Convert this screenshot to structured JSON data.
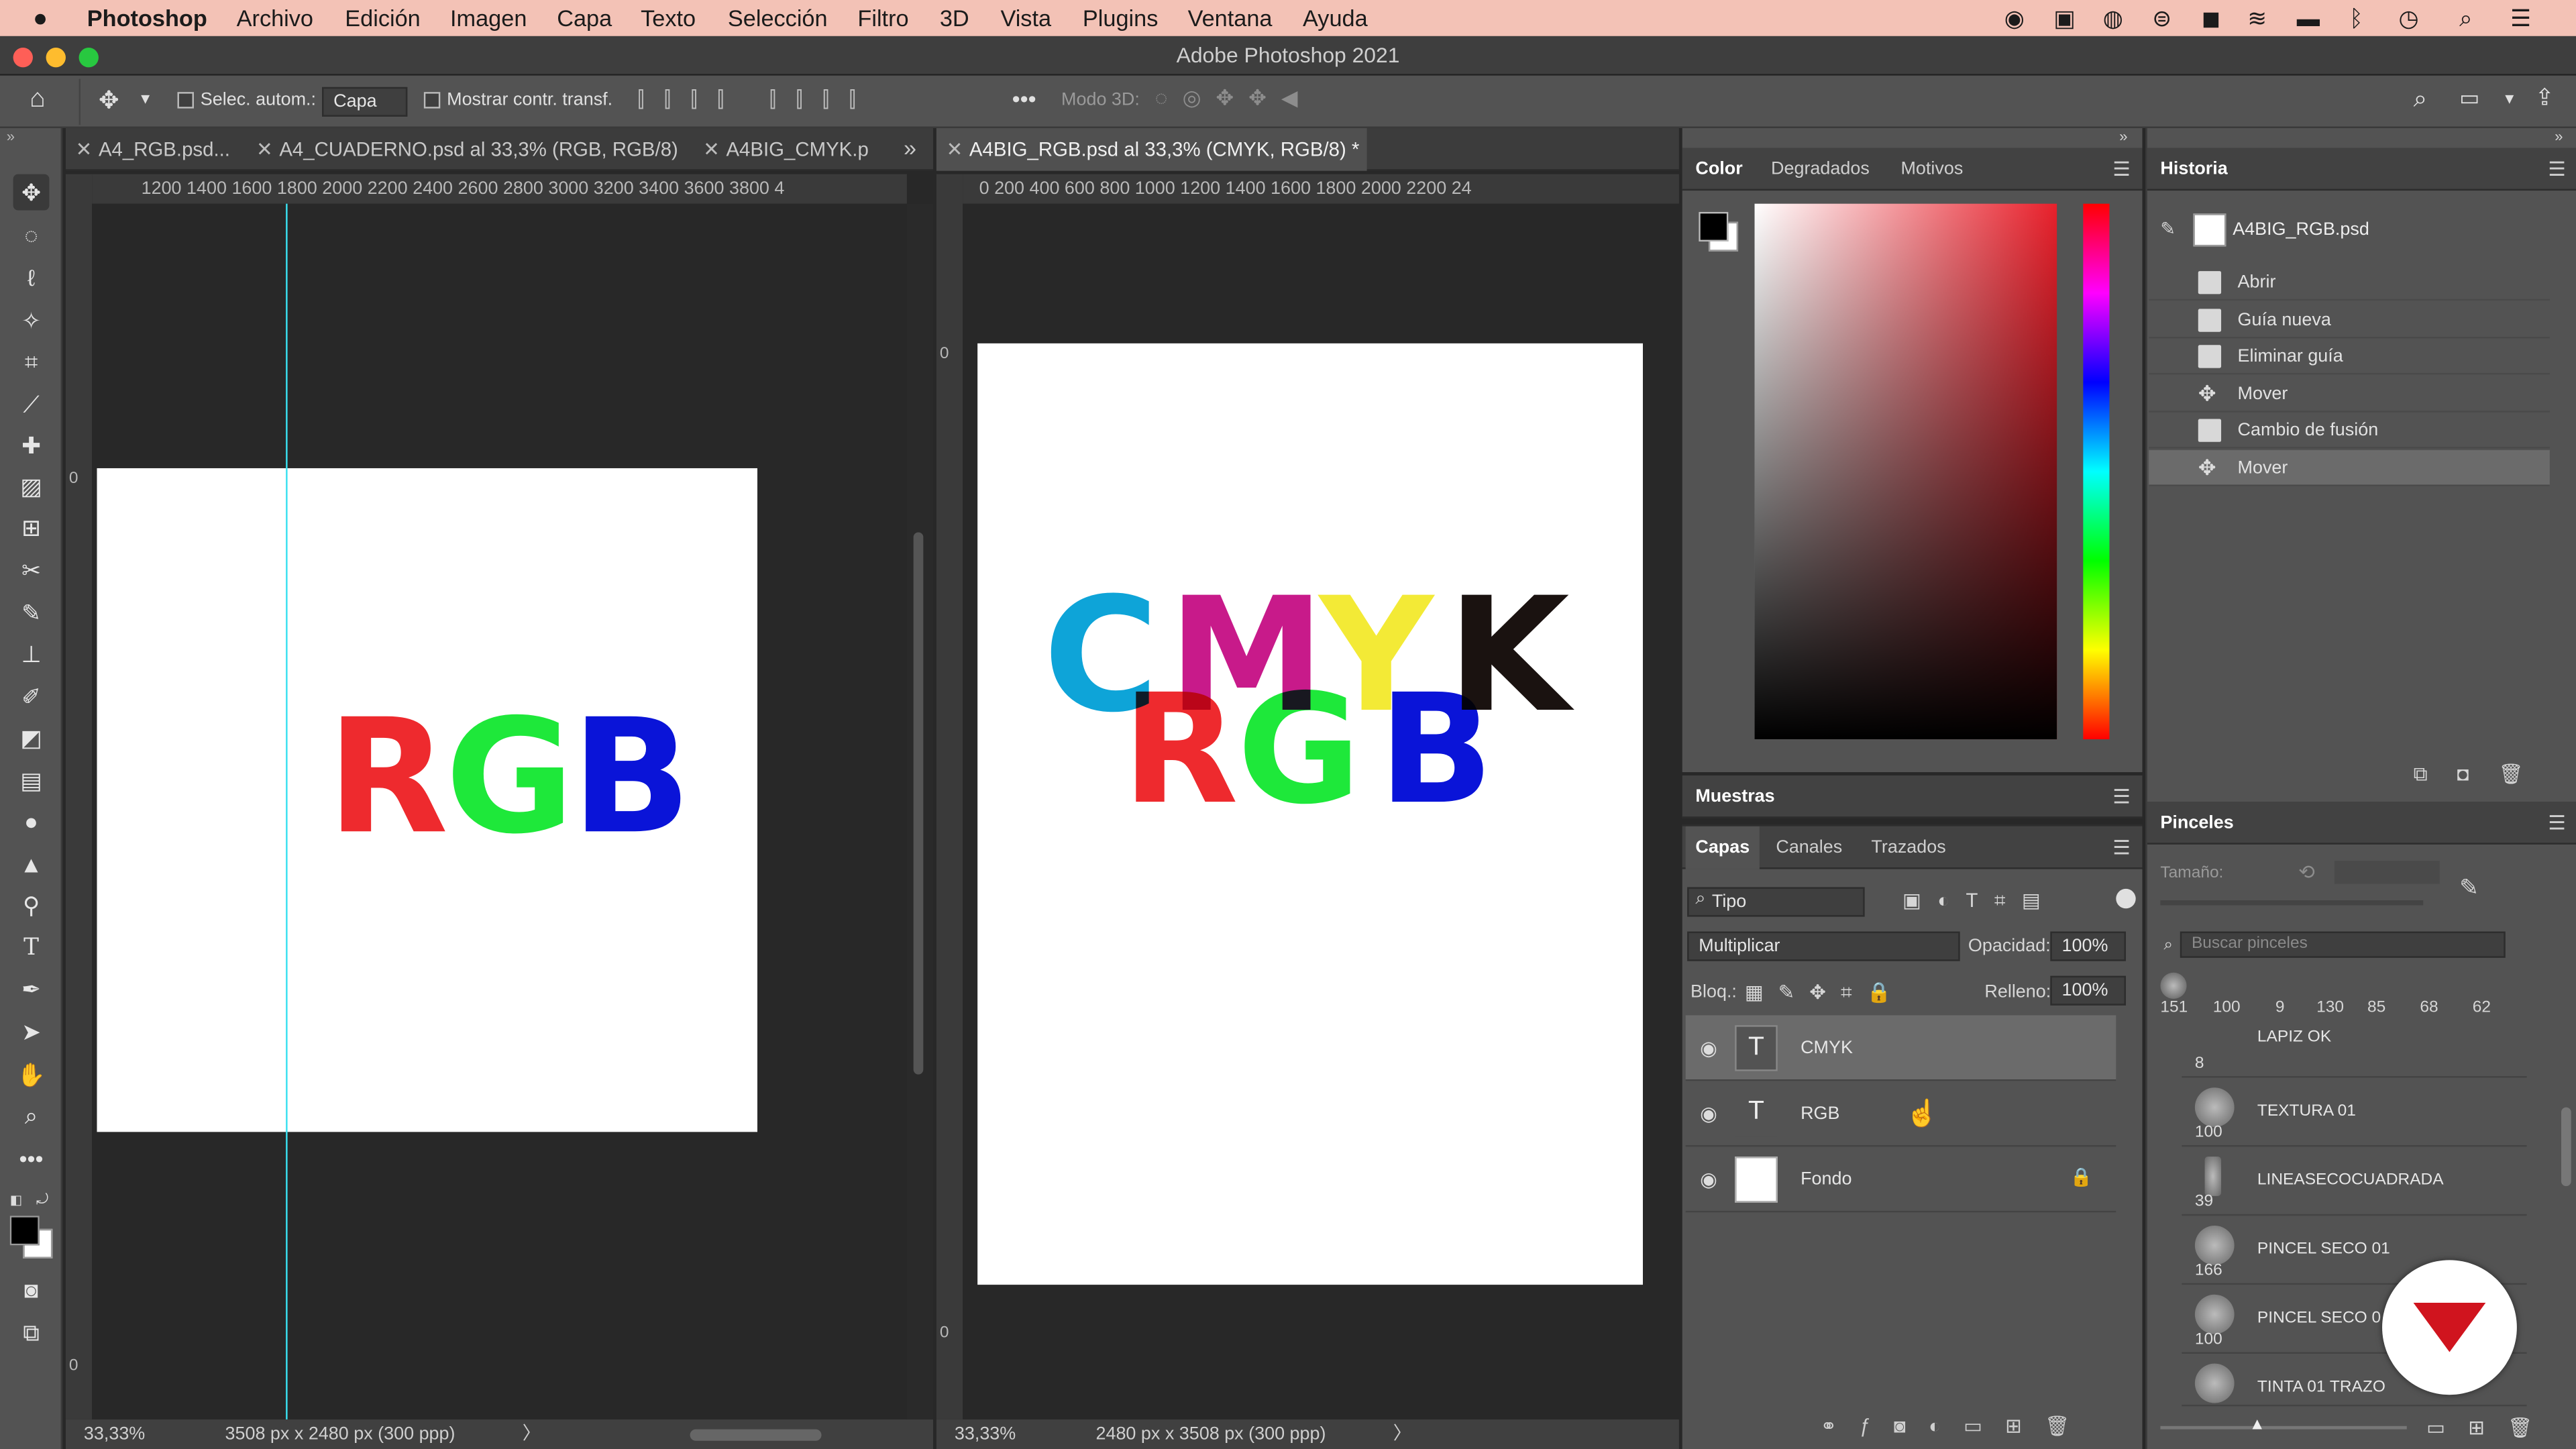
{
  "menubar": {
    "apple": "",
    "app": "Photoshop",
    "items": [
      "Archivo",
      "Edición",
      "Imagen",
      "Capa",
      "Texto",
      "Selección",
      "Filtro",
      "3D",
      "Vista",
      "Plugins",
      "Ventana",
      "Ayuda"
    ]
  },
  "window": {
    "title": "Adobe Photoshop 2021"
  },
  "options": {
    "auto_select_label": "Selec. autom.:",
    "auto_select_value": "Capa",
    "show_transform_label": "Mostrar contr. transf.",
    "mode3d_label": "Modo 3D:"
  },
  "left_doc": {
    "tabs": [
      {
        "label": "A4_RGB.psd..."
      },
      {
        "label": "A4_CUADERNO.psd al 33,3% (RGB, RGB/8) *"
      },
      {
        "label": "A4BIG_CMYK.p"
      }
    ],
    "ruler": "1200 1400 1600 1800 2000 2200 2400 2600 2800 3000 3200 3400 3600 3800 4",
    "vruler": [
      "0",
      "0"
    ],
    "text": "RGB",
    "colors": {
      "r": "#ee2a2e",
      "g": "#1ee83a",
      "b": "#0a14d8"
    },
    "zoom": "33,33%",
    "dims": "3508 px x 2480 px (300 ppp)",
    "arrow": "〉"
  },
  "right_doc": {
    "tab": "A4BIG_RGB.psd al 33,3% (CMYK, RGB/8) *",
    "ruler": "0   200  400  600  800  1000 1200 1400 1600 1800 2000 2200 24",
    "vruler": [
      "0",
      "0"
    ],
    "cmyk": {
      "c": "C",
      "m": "M",
      "y": "Y",
      "k": "K",
      "colors": {
        "c": "#0ea4d8",
        "m": "#c81a8a",
        "y": "#f3ea36",
        "k": "#1a1210"
      }
    },
    "rgb": {
      "r": "R",
      "g": "G",
      "b": "B",
      "colors": {
        "r": "#ee2a2e",
        "g": "#1ee83a",
        "b": "#0a14d8"
      }
    },
    "zoom": "33,33%",
    "dims": "2480 px x 3508 px (300 ppp)",
    "arrow": "〉"
  },
  "color_panel": {
    "tabs": [
      "Color",
      "Degradados",
      "Motivos"
    ]
  },
  "history": {
    "title": "Historia",
    "doc": "A4BIG_RGB.psd",
    "items": [
      "Abrir",
      "Guía nueva",
      "Eliminar guía",
      "Mover",
      "Cambio de fusión",
      "Mover"
    ]
  },
  "swatches": {
    "title": "Muestras"
  },
  "layers": {
    "tabs": [
      "Capas",
      "Canales",
      "Trazados"
    ],
    "filter": "Tipo",
    "blend": "Multiplicar",
    "opacity_label": "Opacidad:",
    "opacity": "100%",
    "lock_label": "Bloq.:",
    "fill_label": "Relleno:",
    "fill": "100%",
    "items": [
      {
        "name": "CMYK",
        "thumb": "T"
      },
      {
        "name": "RGB",
        "thumb": "T"
      },
      {
        "name": "Fondo",
        "thumb": ""
      }
    ]
  },
  "brushes": {
    "title": "Pinceles",
    "size_label": "Tamaño:",
    "search_placeholder": "Buscar pinceles",
    "presets": [
      "151",
      "100",
      "9",
      "130",
      "85",
      "68",
      "62"
    ],
    "items": [
      {
        "name": "LAPIZ OK",
        "size": "8"
      },
      {
        "name": "TEXTURA 01",
        "size": "100"
      },
      {
        "name": "LINEASECOCUADRADA",
        "size": "39"
      },
      {
        "name": "PINCEL SECO 01",
        "size": "166"
      },
      {
        "name": "PINCEL SECO 0",
        "size": "100"
      },
      {
        "name": "TINTA 01 TRAZO",
        "size": ""
      }
    ]
  }
}
